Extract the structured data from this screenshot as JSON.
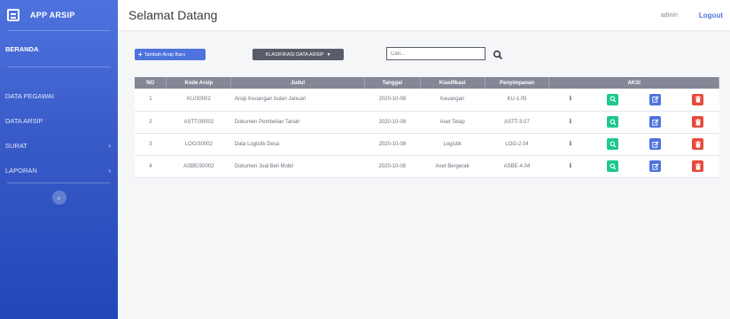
{
  "app": {
    "title": "APP ARSIP"
  },
  "sidebar": {
    "items": [
      {
        "label": "BERANDA"
      },
      {
        "label": "DATA PEGAWAI"
      },
      {
        "label": "DATA ARSIP"
      },
      {
        "label": "SURAT"
      },
      {
        "label": "LAPORAN"
      }
    ]
  },
  "header": {
    "title": "Selamat Datang",
    "user": "admin",
    "logout": "Logout"
  },
  "toolbar": {
    "add_label": "Tambah Arsip Baru",
    "classify_label": "KLASIFIKASI DATA ARSIP",
    "search_placeholder": "Cari..."
  },
  "table": {
    "columns": [
      "NO",
      "Kode Arsip",
      "Judul",
      "Tanggal",
      "Klasifikasi",
      "Penyimpanan",
      "AKSI"
    ],
    "rows": [
      {
        "no": "1",
        "kode": "KU/30002",
        "judul": "Arsip Keuangan bulan Januari",
        "tanggal": "2020-10-08",
        "klasifikasi": "Keuangan",
        "penyimpanan": "KU-1.05"
      },
      {
        "no": "2",
        "kode": "ASTT/30002",
        "judul": "Dokumen Pembelian Tanah",
        "tanggal": "2020-10-08",
        "klasifikasi": "Aset Tetap",
        "penyimpanan": "ASTT-3.07"
      },
      {
        "no": "3",
        "kode": "LOG/30002",
        "judul": "Data Logistik Desa",
        "tanggal": "2020-10-08",
        "klasifikasi": "Logistik",
        "penyimpanan": "LOG-2.04"
      },
      {
        "no": "4",
        "kode": "ASBE/30002",
        "judul": "Dokumen Jual Beli Mobil",
        "tanggal": "2020-10-08",
        "klasifikasi": "Aset Bergerak",
        "penyimpanan": "ASBE-4.04"
      }
    ]
  },
  "colors": {
    "primary": "#4e73df",
    "success": "#1cc88a",
    "danger": "#e74a3b",
    "header": "#858796"
  }
}
